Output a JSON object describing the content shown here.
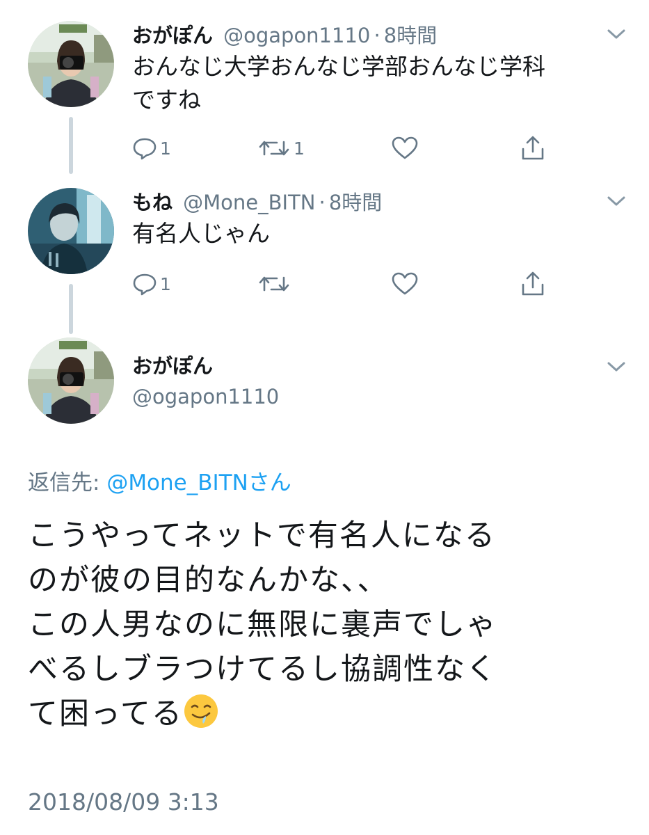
{
  "tweets": [
    {
      "name": "おがぽん",
      "handle": "@ogapon1110",
      "sep": "·",
      "time": "8時間",
      "text_line1": "おんなじ大学おんなじ学部おんなじ学科",
      "text_line2": "ですね",
      "reply_count": "1",
      "retweet_count": "1",
      "avatar_icon": "photographer-avatar"
    },
    {
      "name": "もね",
      "handle": "@Mone_BITN",
      "sep": "·",
      "time": "8時間",
      "text_line1": "有名人じゃん",
      "reply_count": "1",
      "retweet_count": "",
      "avatar_icon": "blue-portrait-avatar"
    }
  ],
  "main_tweet": {
    "name": "おがぽん",
    "handle": "@ogapon1110",
    "reply_prefix": "返信先: ",
    "reply_target": "@Mone_BITNさん",
    "lines": [
      "こうやってネットで有名人になる",
      "のが彼の目的なんかな、、",
      "この人男なのに無限に裏声でしゃ",
      "べるしブラつけてるし協調性なく",
      "て困ってる"
    ],
    "emoji": "drooling-face-emoji",
    "timestamp": "2018/08/09 3:13"
  },
  "colors": {
    "text": "#14171a",
    "secondary": "#657786",
    "link": "#1da1f2",
    "thread_line": "#ccd6dd"
  }
}
